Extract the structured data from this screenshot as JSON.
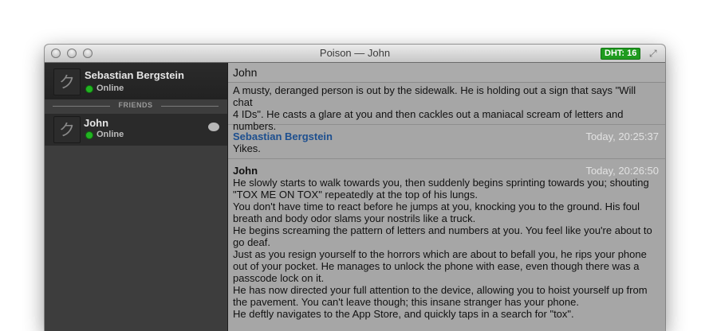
{
  "window": {
    "title": "Poison — John",
    "dht_badge": "DHT: 16"
  },
  "sidebar": {
    "self": {
      "name": "Sebastian Bergstein",
      "status": "Online",
      "avatar_glyph": "ク"
    },
    "friends_header": "FRIENDS",
    "friends": [
      {
        "name": "John",
        "status": "Online",
        "avatar_glyph": "ク"
      }
    ]
  },
  "chat": {
    "title": "John",
    "messages": [
      {
        "sender": "",
        "time": "",
        "lines": [
          "A musty, deranged person is out by the sidewalk. He is holding out a sign that says \"Will chat",
          "4 IDs\". He casts a glare at you and then cackles out a maniacal scream of letters and",
          "numbers."
        ]
      },
      {
        "sender": "Sebastian Bergstein",
        "time": "Today, 20:25:37",
        "lines": [
          "Yikes."
        ]
      },
      {
        "sender": "John",
        "time": "Today, 20:26:50",
        "lines": [
          "He slowly starts to walk towards you, then suddenly begins sprinting towards you; shouting",
          "\"TOX ME ON TOX\" repeatedly at the top of his lungs.",
          "You don't have time to react before he jumps at you, knocking you to the ground. His foul",
          "breath and body odor slams your nostrils like a truck.",
          "He begins screaming the pattern of letters and numbers at you. You feel like you're about to",
          "go deaf.",
          "Just as you resign yourself to the horrors which are about to befall you, he rips your phone",
          "out of your pocket. He manages to unlock the phone with ease, even though there was a",
          "passcode lock on it.",
          "He has now directed your full attention to the device, allowing you to hoist yourself up from",
          "the pavement. You can't leave though; this insane stranger has your phone.",
          "He deftly navigates to the App Store, and quickly taps in a search for \"tox\"."
        ]
      }
    ]
  },
  "colors": {
    "self_sender": "#1d4f8f",
    "friend_sender": "#111111",
    "dht_badge": "#1f9b1f",
    "online_dot": "#22b322"
  },
  "icons": [
    "close-button-icon",
    "minimize-button-icon",
    "zoom-button-icon",
    "fullscreen-icon",
    "speech-bubble-icon"
  ]
}
